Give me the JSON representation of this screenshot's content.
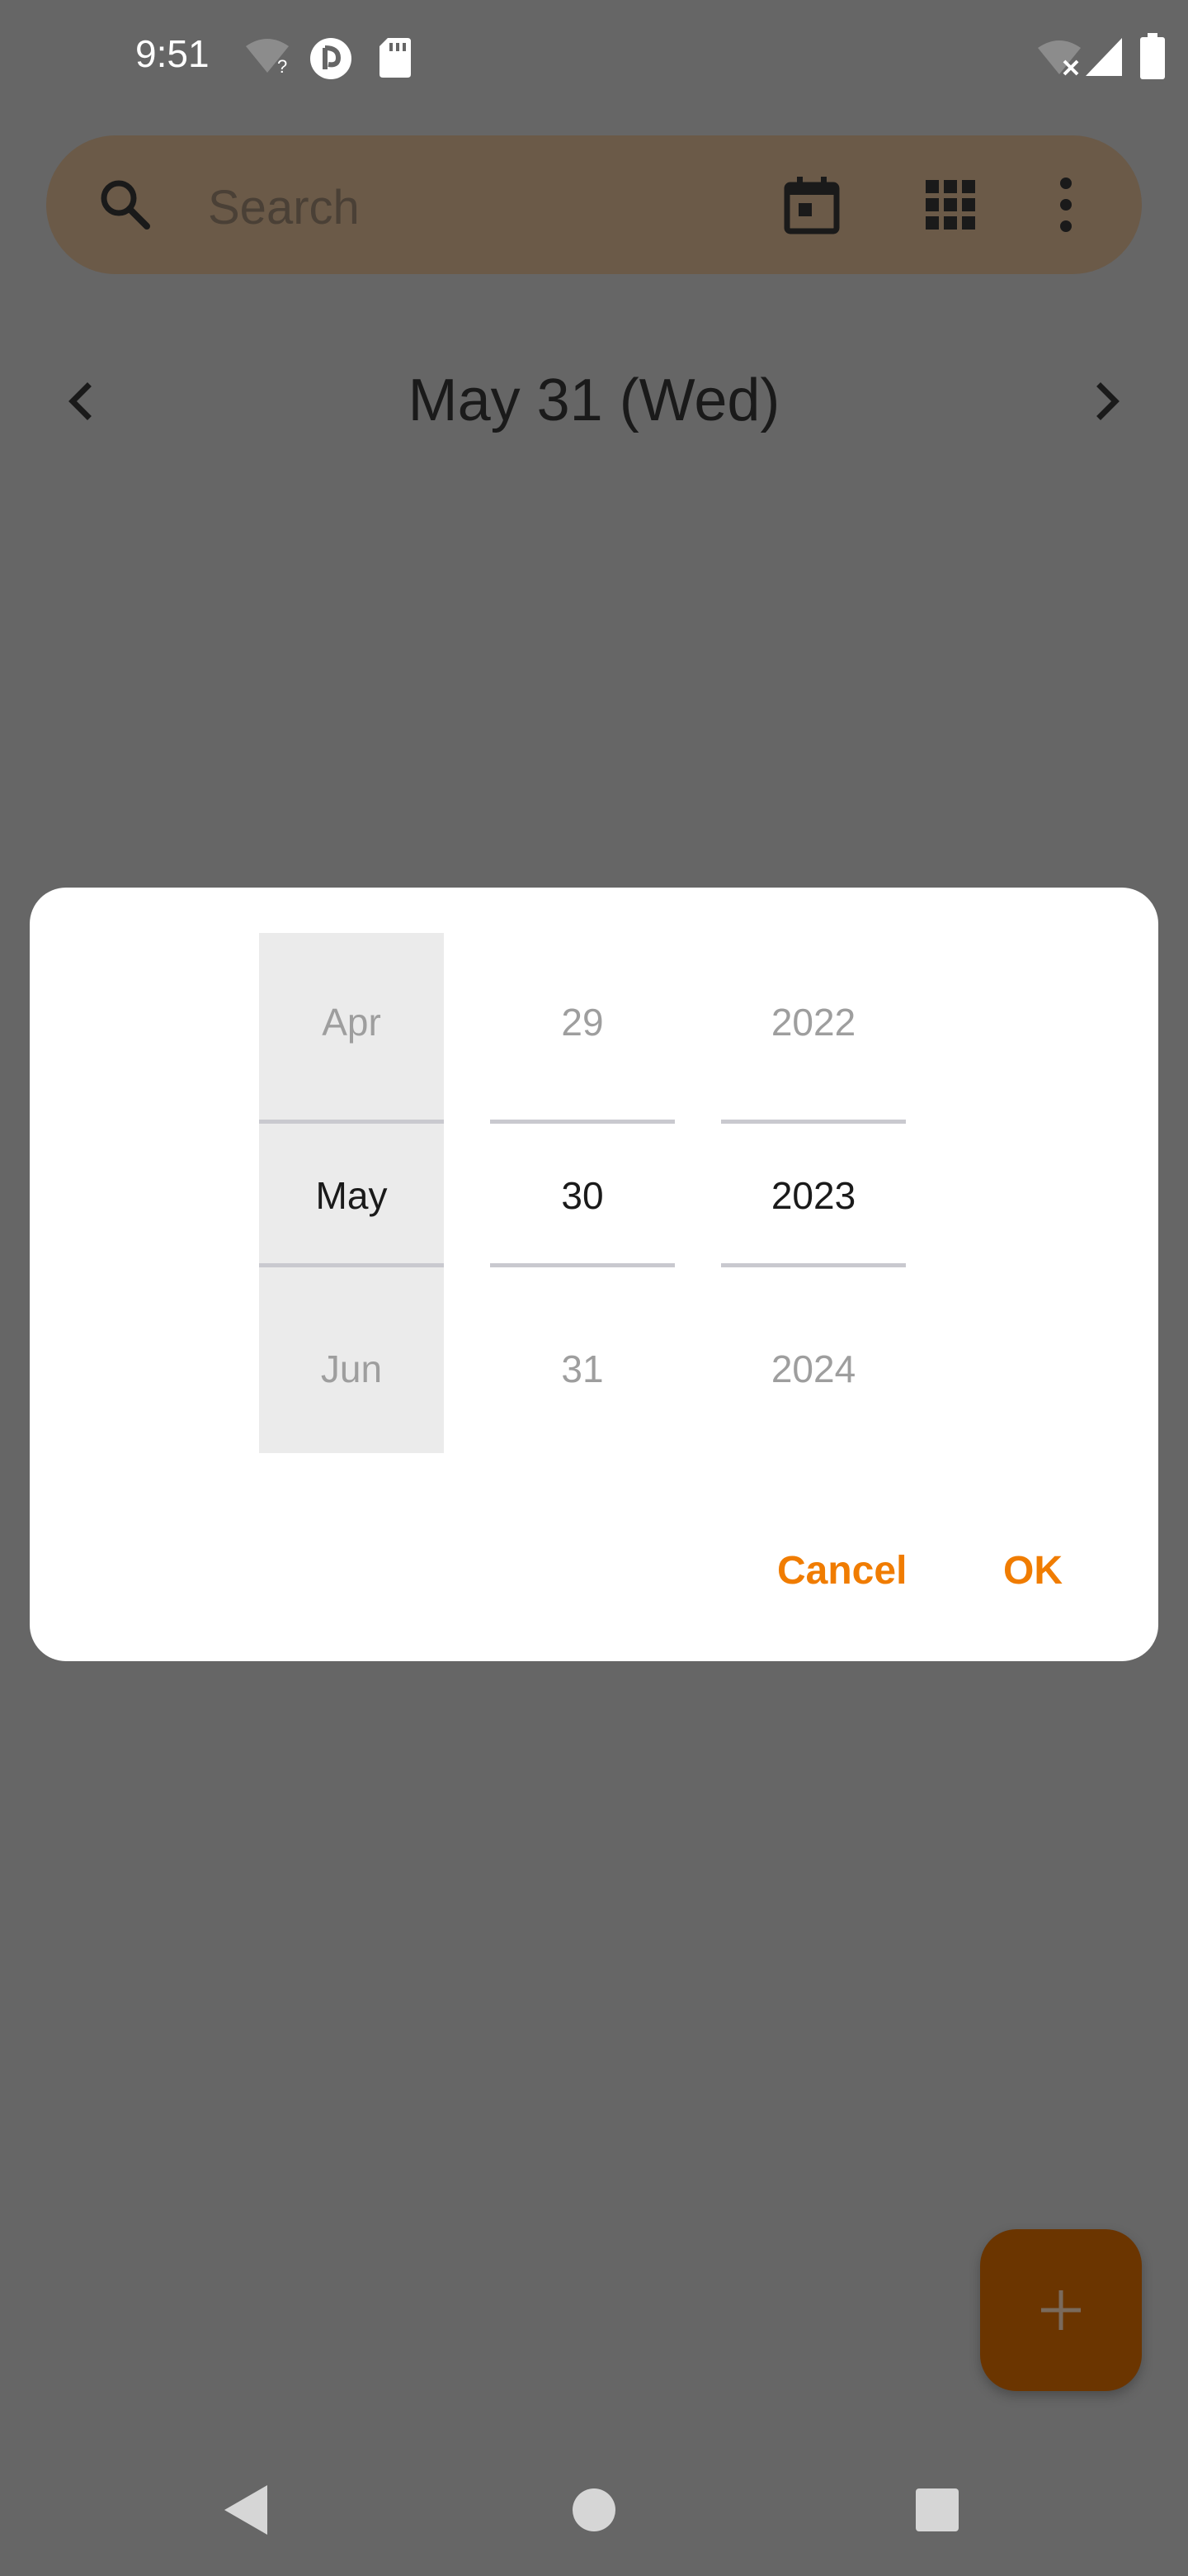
{
  "status_bar": {
    "time": "9:51"
  },
  "search": {
    "placeholder": "Search",
    "icons": [
      "search-icon",
      "calendar-icon",
      "grid-icon",
      "more-vert-icon"
    ]
  },
  "date_header": {
    "title": "May 31 (Wed)"
  },
  "date_picker": {
    "month": {
      "prev": "Apr",
      "selected": "May",
      "next": "Jun"
    },
    "day": {
      "prev": "29",
      "selected": "30",
      "next": "31"
    },
    "year": {
      "prev": "2022",
      "selected": "2023",
      "next": "2024"
    },
    "cancel_label": "Cancel",
    "ok_label": "OK"
  },
  "fab": {
    "icon": "plus-icon"
  },
  "colors": {
    "scrim_background": "#666666",
    "search_bar": "#6b5a48",
    "accent": "#f07c00",
    "fab": "#6b3500"
  }
}
